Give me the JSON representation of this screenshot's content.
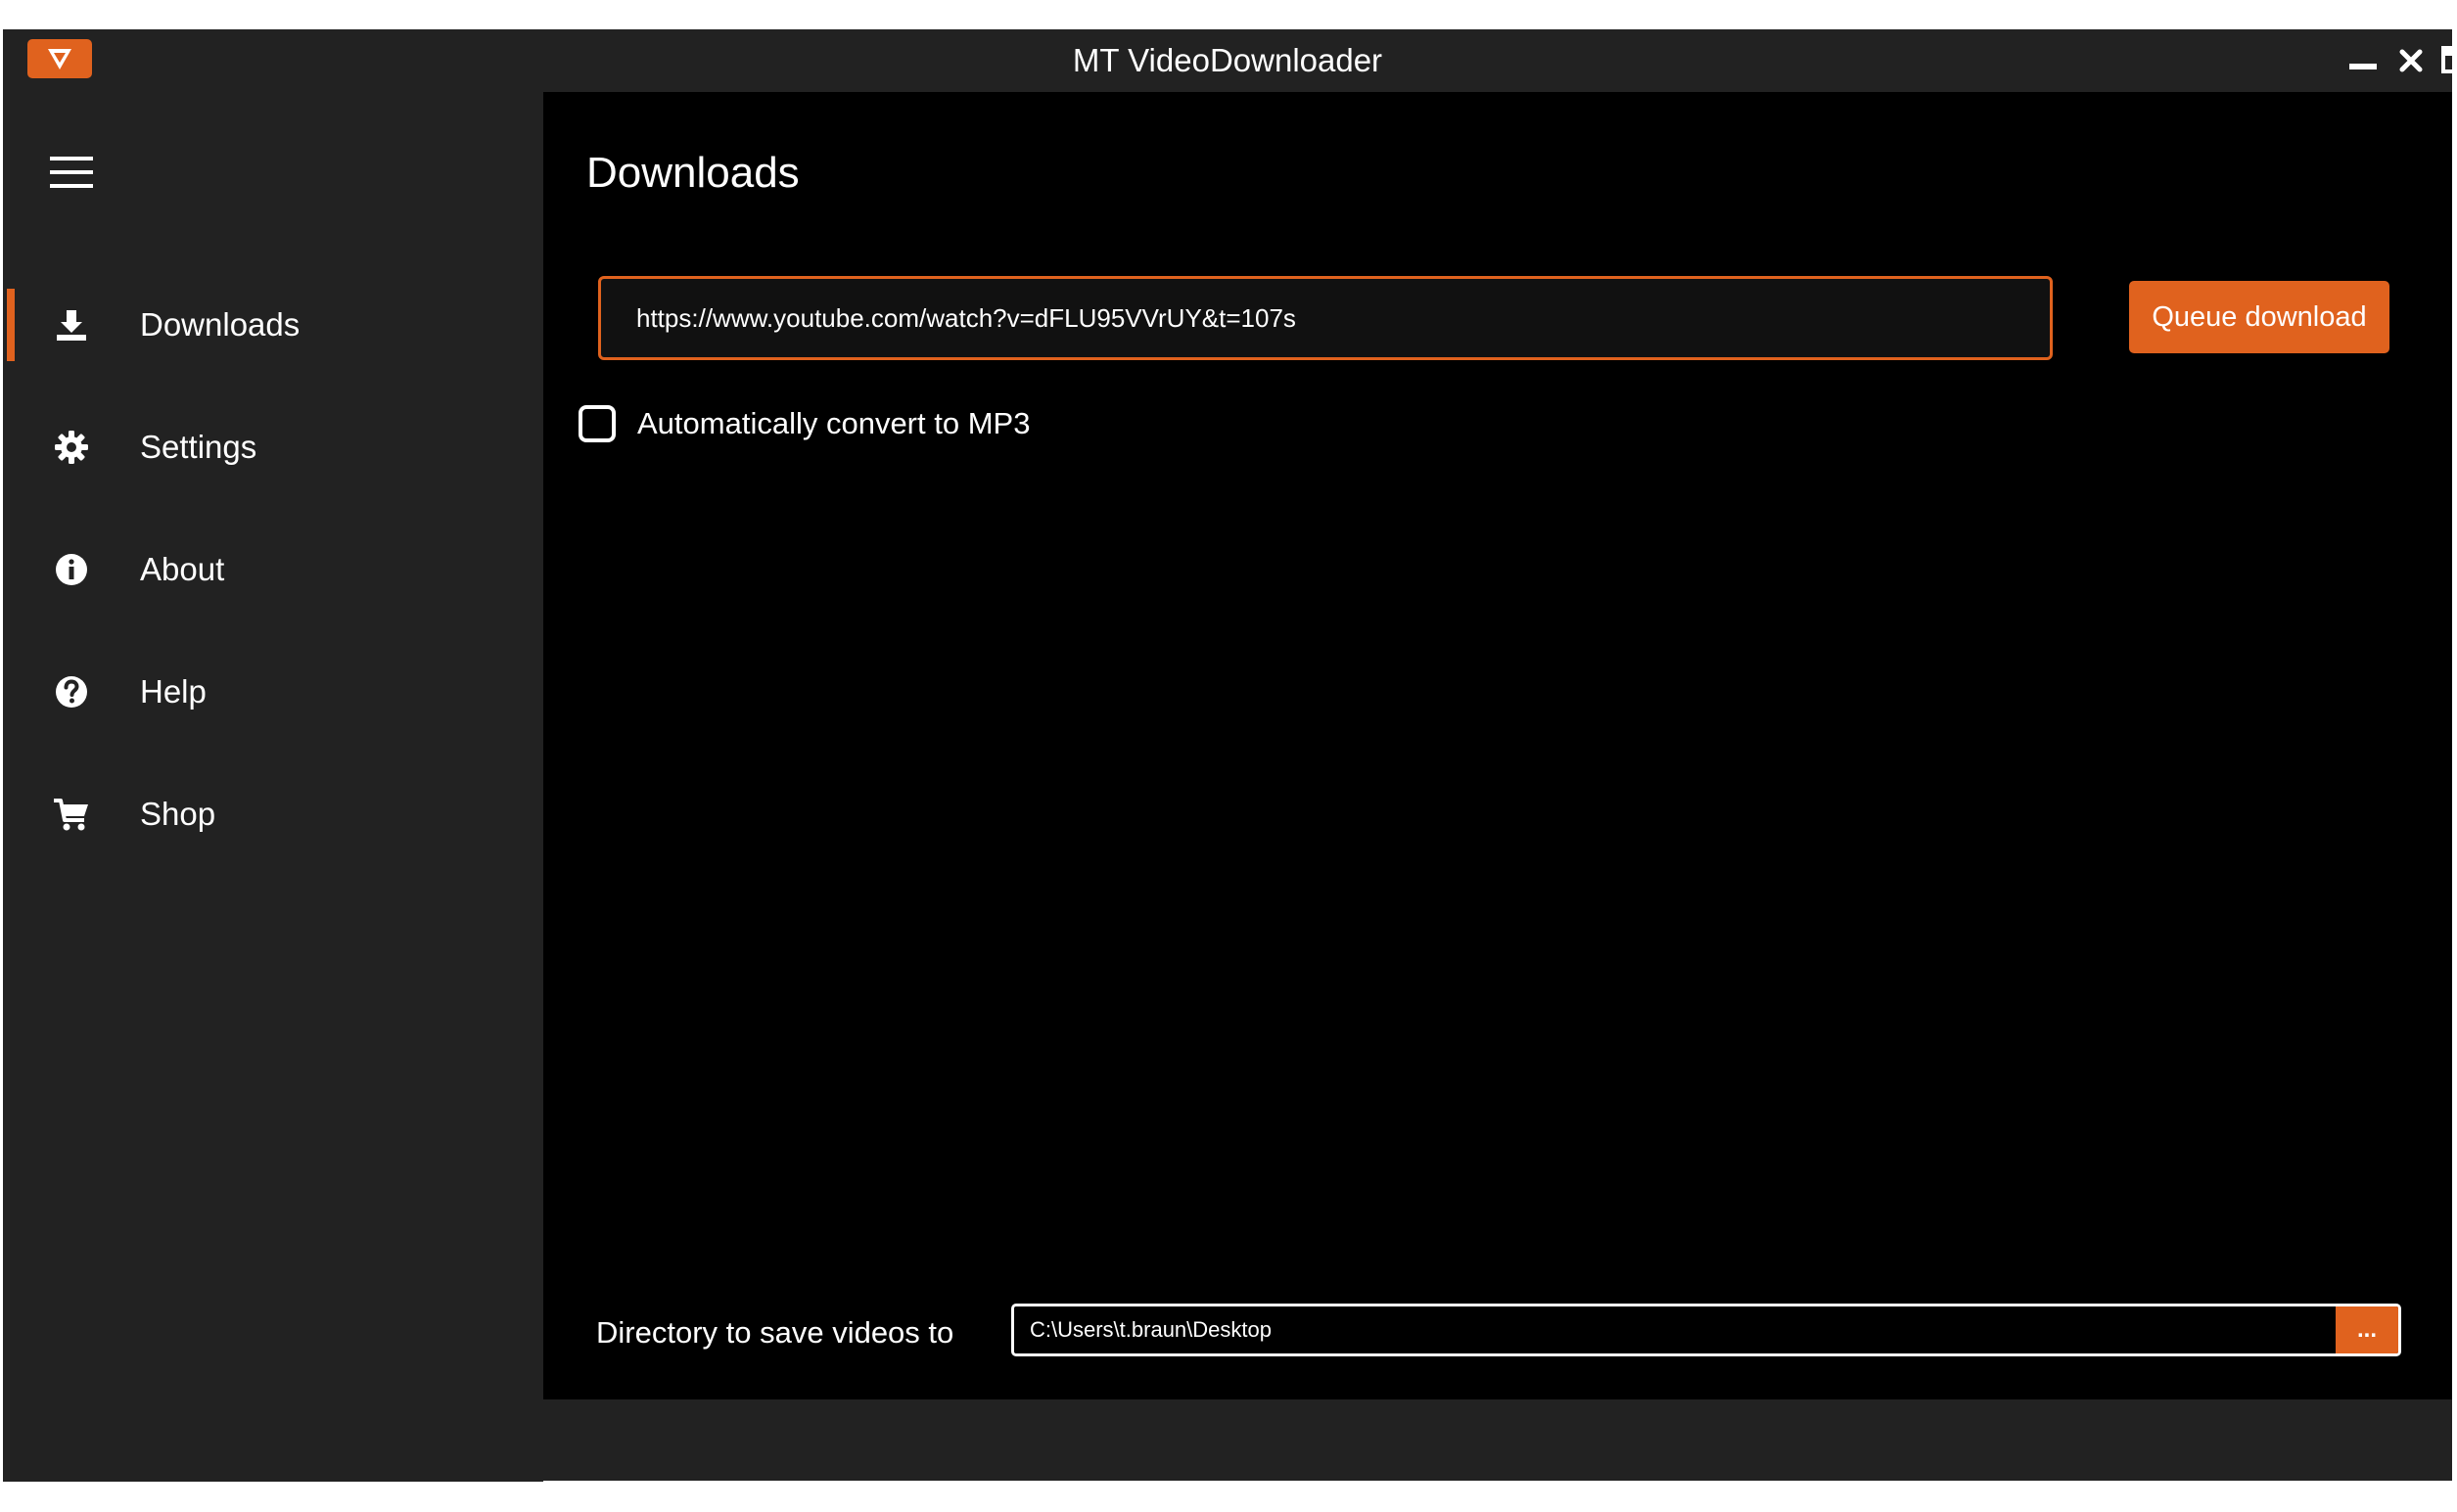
{
  "window": {
    "title": "MT VideoDownloader",
    "accent_color": "#e0621e",
    "controls": [
      "minimize-icon",
      "maximize-icon",
      "close-icon"
    ]
  },
  "sidebar": {
    "menu_icon": "hamburger-icon",
    "active_item": "Downloads",
    "items": [
      {
        "label": "Downloads",
        "icon": "download-icon"
      },
      {
        "label": "Settings",
        "icon": "gear-icon"
      },
      {
        "label": "About",
        "icon": "info-icon"
      },
      {
        "label": "Help",
        "icon": "help-icon"
      },
      {
        "label": "Shop",
        "icon": "cart-icon"
      }
    ]
  },
  "main": {
    "page_title": "Downloads",
    "url_input_value": "https://www.youtube.com/watch?v=dFLU95VVrUY&t=107s",
    "queue_button_label": "Queue download",
    "convert_mp3": {
      "label": "Automatically convert to MP3",
      "checked": false
    },
    "directory": {
      "label": "Directory to save videos to",
      "value": "C:\\Users\\t.braun\\Desktop",
      "browse_label": "..."
    }
  }
}
